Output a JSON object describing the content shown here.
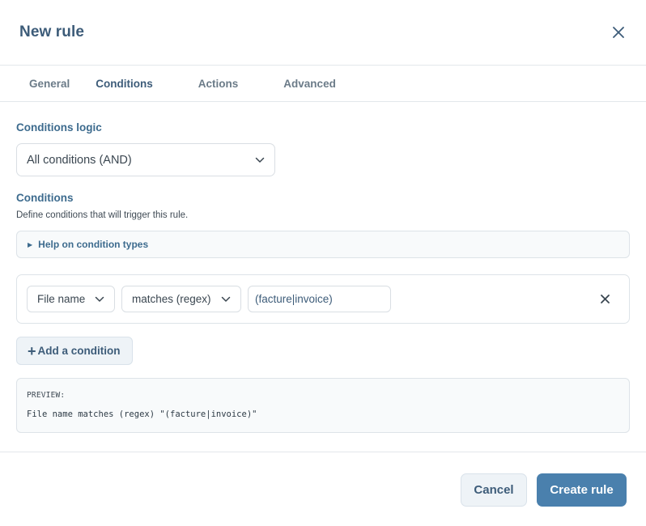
{
  "dialog": {
    "title": "New rule"
  },
  "tabs": [
    {
      "label": "General",
      "active": false
    },
    {
      "label": "Conditions",
      "active": true
    },
    {
      "label": "Actions",
      "active": false
    },
    {
      "label": "Advanced",
      "active": false
    }
  ],
  "conditions_logic": {
    "label": "Conditions logic",
    "selected": "All conditions (AND)"
  },
  "conditions": {
    "label": "Conditions",
    "description": "Define conditions that will trigger this rule.",
    "help_toggle": "Help on condition types",
    "items": [
      {
        "field": "File name",
        "operator": "matches (regex)",
        "value": "(facture|invoice)"
      }
    ],
    "add_label": "Add a condition"
  },
  "preview": {
    "label": "PREVIEW:",
    "text": "File name matches (regex) \"(facture|invoice)\""
  },
  "footer": {
    "cancel_label": "Cancel",
    "create_label": "Create rule"
  },
  "icons": {
    "close": "close-icon",
    "chevron": "chevron-down-icon",
    "triangle": "triangle-right-icon",
    "plus": "plus-icon"
  },
  "colors": {
    "accent": "#4a80ad",
    "title": "#3d5c79",
    "label": "#3d6b8e"
  }
}
